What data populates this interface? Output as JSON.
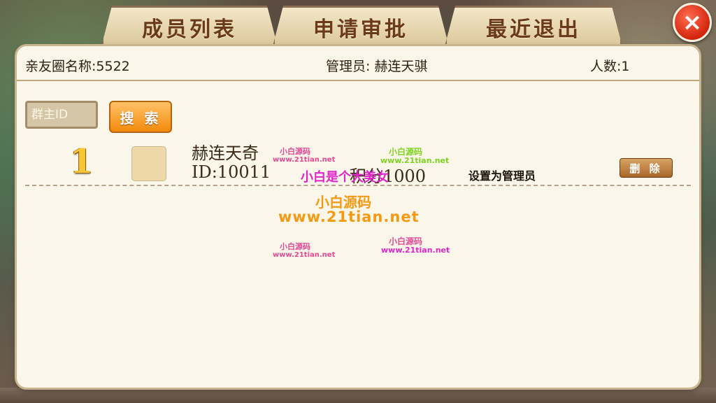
{
  "tabs": [
    {
      "label": "成员列表"
    },
    {
      "label": "申请审批"
    },
    {
      "label": "最近退出"
    }
  ],
  "close_icon": "×",
  "info": {
    "circle_name": "亲友圈名称:5522",
    "admin": "管理员:  赫连天骐",
    "count": "人数:1"
  },
  "search": {
    "placeholder": "群主ID",
    "button_label": "搜 索"
  },
  "members": [
    {
      "rank": "1",
      "nickname": "赫连天奇",
      "id": "ID:10011",
      "score": "积分1000",
      "set_admin_label": "设置为管理员",
      "delete_label": "删 除"
    }
  ],
  "watermarks": {
    "a": "小白源码",
    "a2": "www.21tian.net",
    "b": "小白源码",
    "b2": "www.21tian.net",
    "c": "小白是个大美女",
    "d": "小白源码",
    "e": "www.21tian.net",
    "f": "小白源码",
    "f2": "www.21tian.net",
    "g": "小白源码",
    "g2": "www.21tian.net"
  },
  "colors": {
    "tab_text": "#6b3a1a",
    "close_red": "#d3240e",
    "search_orange": "#f28a0c",
    "panel_bg": "#fbf6ea"
  }
}
